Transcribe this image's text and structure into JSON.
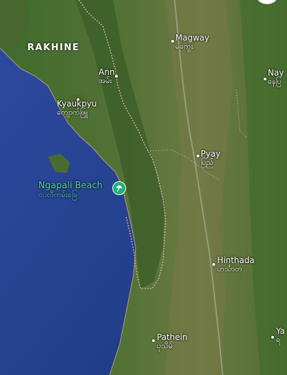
{
  "region": "RAKHINE",
  "poi": {
    "name": "Ngapali Beach",
    "name_local": "ငပလီကမ်းခြေ",
    "icon": "beach-umbrella-icon",
    "color": "#57d6a0"
  },
  "places": [
    {
      "id": "magway",
      "name": "Magway",
      "name_local": "မကွေး"
    },
    {
      "id": "ann",
      "name": "Ann",
      "name_local": "အမ်း"
    },
    {
      "id": "kyaukpyu",
      "name": "Kyaukpyu",
      "name_local": "ကျောက်ဖြူ"
    },
    {
      "id": "pyay",
      "name": "Pyay",
      "name_local": "ပြည်"
    },
    {
      "id": "hinthada",
      "name": "Hinthada",
      "name_local": "ဟင်္သာတ"
    },
    {
      "id": "pathein",
      "name": "Pathein",
      "name_local": "ပုသိမ်"
    },
    {
      "id": "nay",
      "name": "Nay",
      "name_local": "နေပြ"
    },
    {
      "id": "ya",
      "name": "Ya",
      "name_local": "ရ"
    }
  ],
  "colors": {
    "sea": "#203a7a",
    "land": "#4d6b34",
    "border": "#e8b6b0"
  }
}
